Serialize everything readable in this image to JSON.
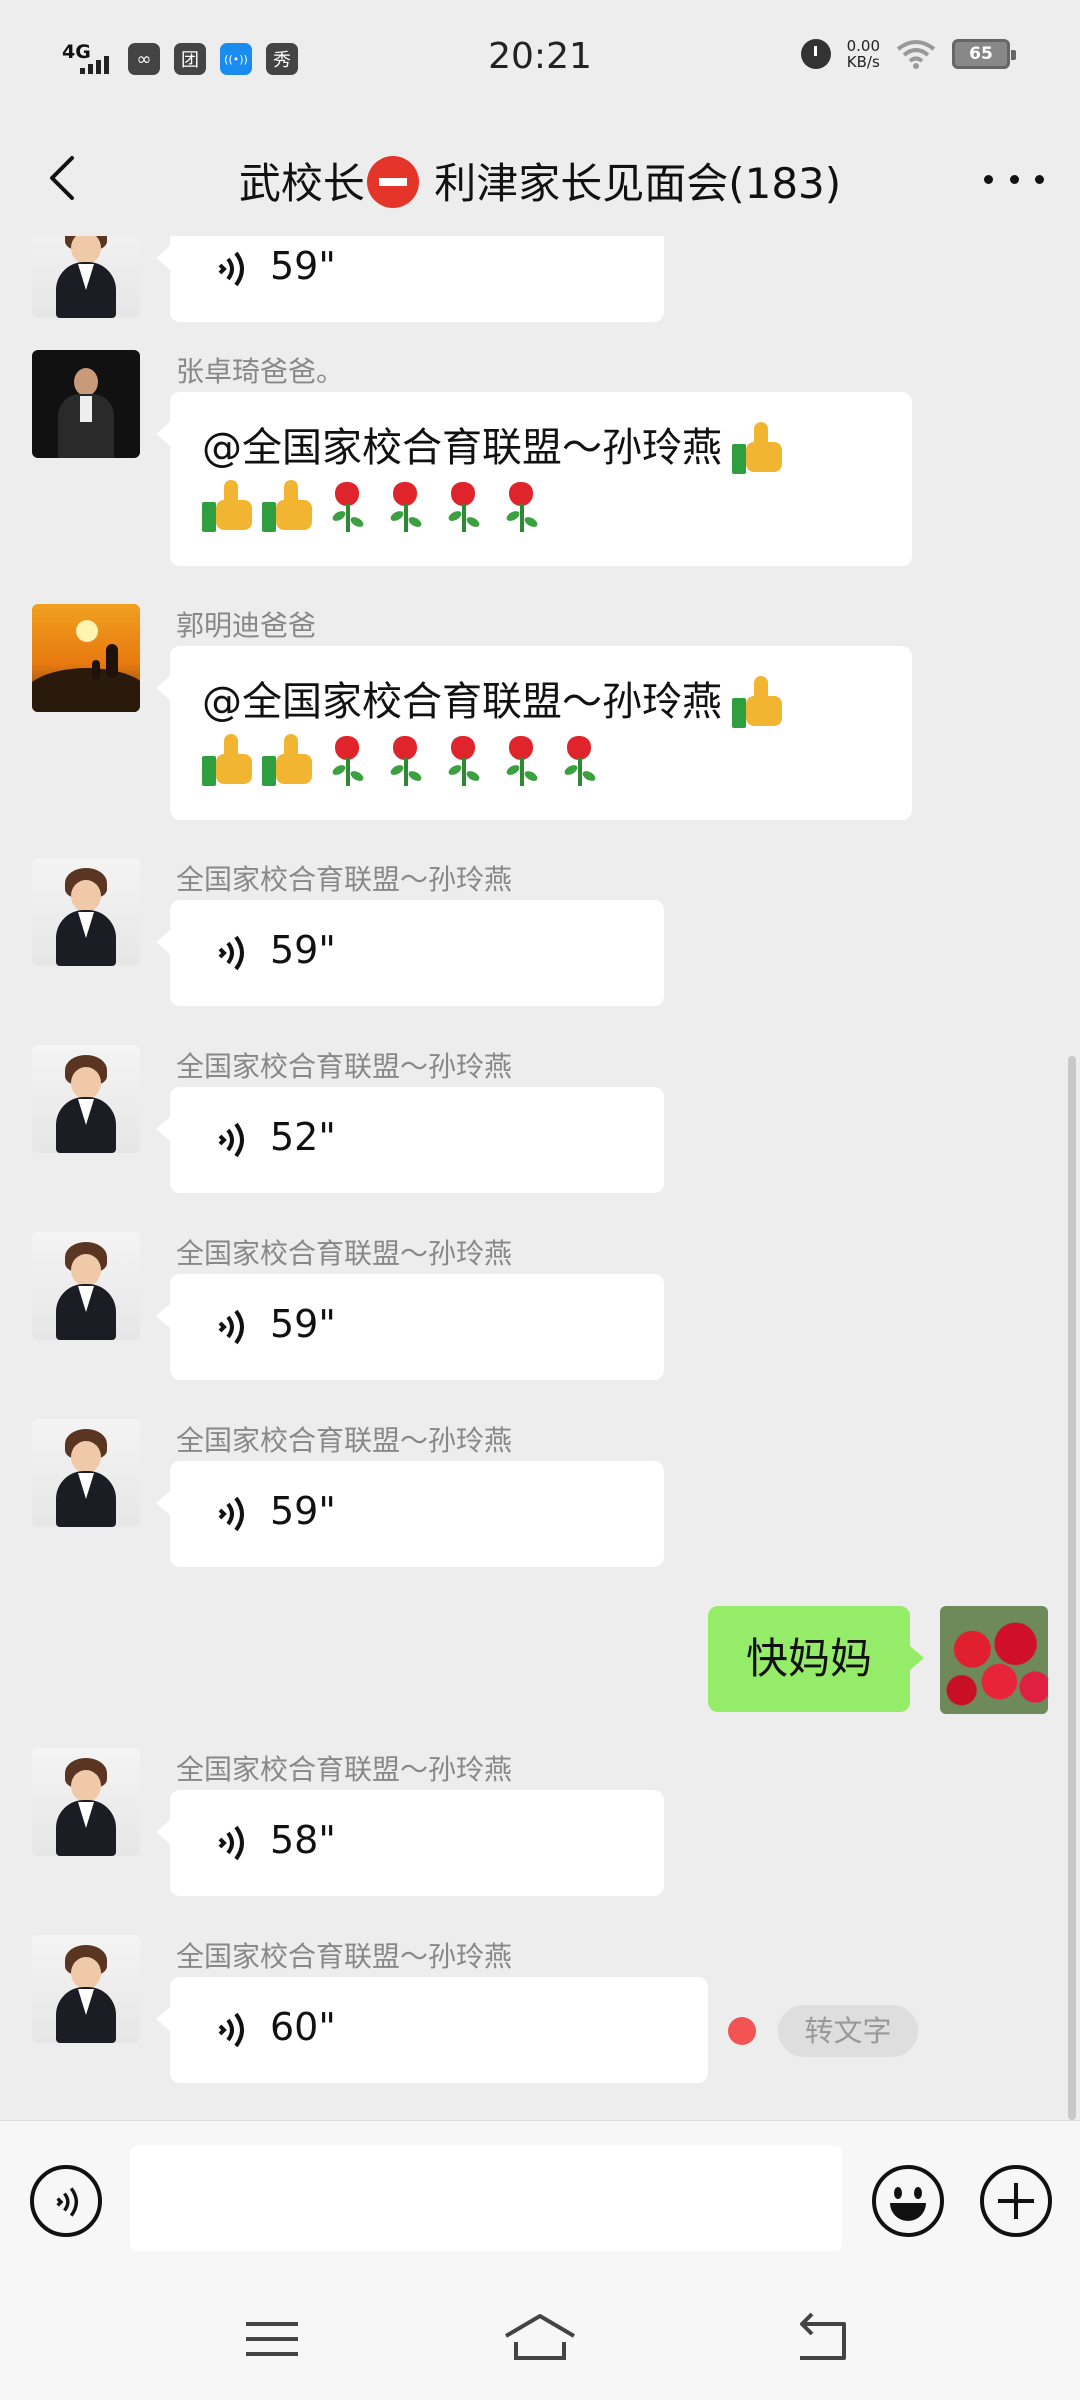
{
  "status_bar": {
    "network": "4G",
    "time": "20:21",
    "speed_value": "0.00",
    "speed_unit": "KB/s",
    "battery": "65",
    "app_icons": [
      "link-icon",
      "calendar-icon",
      "antenna-icon",
      "show-icon"
    ],
    "app_icon_glyphs": [
      "∞",
      "团",
      "((•))",
      "秀"
    ]
  },
  "header": {
    "title_prefix": "武校长",
    "title_suffix": "利津家长见面会(183)"
  },
  "messages": [
    {
      "sender": "",
      "duration": "59\"",
      "type": "voice"
    },
    {
      "sender": "张卓琦爸爸。",
      "type": "text",
      "mention": "@全国家校合育联盟～孙玲燕",
      "roses": 4
    },
    {
      "sender": "郭明迪爸爸",
      "type": "text",
      "mention": "@全国家校合育联盟～孙玲燕",
      "roses": 5
    },
    {
      "sender": "全国家校合育联盟～孙玲燕",
      "duration": "59\"",
      "type": "voice"
    },
    {
      "sender": "全国家校合育联盟～孙玲燕",
      "duration": "52\"",
      "type": "voice"
    },
    {
      "sender": "全国家校合育联盟～孙玲燕",
      "duration": "59\"",
      "type": "voice"
    },
    {
      "sender": "全国家校合育联盟～孙玲燕",
      "duration": "59\"",
      "type": "voice"
    },
    {
      "sender": "me",
      "type": "text",
      "text": "快妈妈"
    },
    {
      "sender": "全国家校合育联盟～孙玲燕",
      "duration": "58\"",
      "type": "voice"
    },
    {
      "sender": "全国家校合育联盟～孙玲燕",
      "duration": "60\"",
      "type": "voice",
      "transcribe_label": "转文字"
    }
  ],
  "colors": {
    "background": "#ededed",
    "my_bubble": "#95ec69",
    "their_bubble": "#ffffff",
    "unread_dot": "#f25454"
  }
}
